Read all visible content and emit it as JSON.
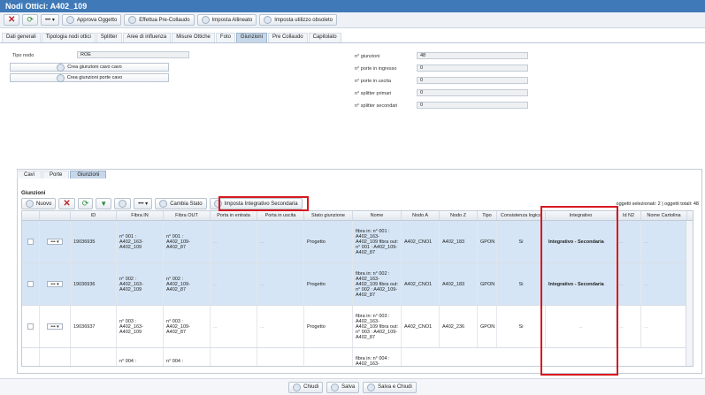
{
  "window": {
    "title": "Nodi Ottici: A402_109"
  },
  "toolbar": {
    "approve": "Approva Oggetto",
    "precollaudo": "Effettua Pre-Collaudo",
    "allineato": "Imposta Allineato",
    "obsoleto": "Imposta utilizzo obsoleto",
    "more": "••• ▾"
  },
  "tabs": [
    "Dati generali",
    "Tipologia nodi ottici",
    "Splitter",
    "Aree di influenza",
    "Misure Ottiche",
    "Foto",
    "Giunzioni",
    "Pre Collaudo",
    "Capitolato"
  ],
  "form": {
    "tipo_nodo_label": "Tipo nodo",
    "tipo_nodo_value": "ROE",
    "btn_cavo": "Crea giunzioni cavo cavo",
    "btn_porte": "Crea giunzioni porte cavo",
    "giunzioni_label": "n° giunzioni",
    "giunzioni_value": "48",
    "porte_in_label": "n° porte in ingresso",
    "porte_in_value": "0",
    "porte_out_label": "n° porte in uscita",
    "porte_out_value": "0",
    "split1_label": "n° splitter primari",
    "split1_value": "0",
    "split2_label": "n° splitter secondari",
    "split2_value": "0"
  },
  "subtabs": [
    "Cavi",
    "Porte",
    "Giunzioni"
  ],
  "grid": {
    "title": "Giunzioni",
    "new": "Nuovo",
    "cambia": "Cambia Stato",
    "integrativo": "Imposta Integrativo Secondaria",
    "count": "oggetti selezionati: 2 | oggetti totali: 48",
    "headers": [
      "",
      "",
      "ID",
      "Fibra IN",
      "Fibra OUT",
      "Porta in entrata",
      "Porta in uscita",
      "Stato giunzione",
      "Nome",
      "Nodo A",
      "Nodo Z",
      "Tipo",
      "Consistenza logica",
      "Integrativo",
      "Id N2",
      "Nome Cartolina"
    ],
    "rows": [
      {
        "id": "19036935",
        "fin": "n° 001 : A402_163- A402_109",
        "fout": "n° 001 : A402_109- A402_87",
        "pin": "...",
        "pout": "...",
        "stato": "Progetto",
        "nome": "fibra in: n° 001 : A402_163- A402_109 fibra out: n° 001 : A402_109- A402_87",
        "a": "A402_CNO1",
        "z": "A402_183",
        "tipo": "GPON",
        "cons": "Si",
        "integ": "Integrativo - Secondaria",
        "n2": "...",
        "cart": "...",
        "sel": true
      },
      {
        "id": "19036936",
        "fin": "n° 002 : A402_163- A402_109",
        "fout": "n° 002 : A402_109- A402_87",
        "pin": "...",
        "pout": "...",
        "stato": "Progetto",
        "nome": "fibra in: n° 002 : A402_163- A402_109 fibra out: n° 002 : A402_109- A402_87",
        "a": "A402_CNO1",
        "z": "A402_183",
        "tipo": "GPON",
        "cons": "Si",
        "integ": "Integrativo - Secondaria",
        "n2": "...",
        "cart": "...",
        "sel": true
      },
      {
        "id": "19036937",
        "fin": "n° 003 : A402_163- A402_109",
        "fout": "n° 003 : A402_109- A402_87",
        "pin": "...",
        "pout": "...",
        "stato": "Progetto",
        "nome": "fibra in: n° 003 : A402_163- A402_109 fibra out: n° 003 : A402_109- A402_87",
        "a": "A402_CNO1",
        "z": "A402_236",
        "tipo": "GPON",
        "cons": "Si",
        "integ": "...",
        "n2": "...",
        "cart": "...",
        "sel": false
      },
      {
        "id": "",
        "fin": "n° 004 :",
        "fout": "n° 004 :",
        "pin": "",
        "pout": "",
        "stato": "",
        "nome": "fibra in: n° 004 : A402_163-",
        "a": "",
        "z": "",
        "tipo": "",
        "cons": "",
        "integ": "",
        "n2": "",
        "cart": "",
        "sel": false
      }
    ]
  },
  "footer": {
    "chiudi": "Chiudi",
    "salva": "Salva",
    "salva_chiudi": "Salva e Chiudi"
  }
}
